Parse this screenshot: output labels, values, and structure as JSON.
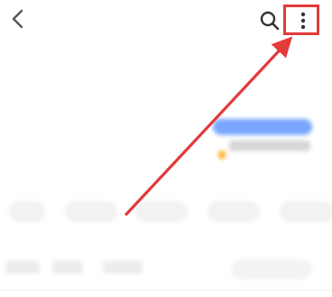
{
  "header": {
    "back_icon": "chevron-left-icon",
    "search_icon": "search-icon",
    "more_icon": "more-vertical-icon",
    "highlight_color": "#e33a3a"
  },
  "article": {
    "title_line1": "",
    "title_line2": "",
    "desc_line1": "",
    "desc_line2": "",
    "desc_line3": ""
  },
  "annotation": {
    "arrow_color": "#e33a3a"
  }
}
